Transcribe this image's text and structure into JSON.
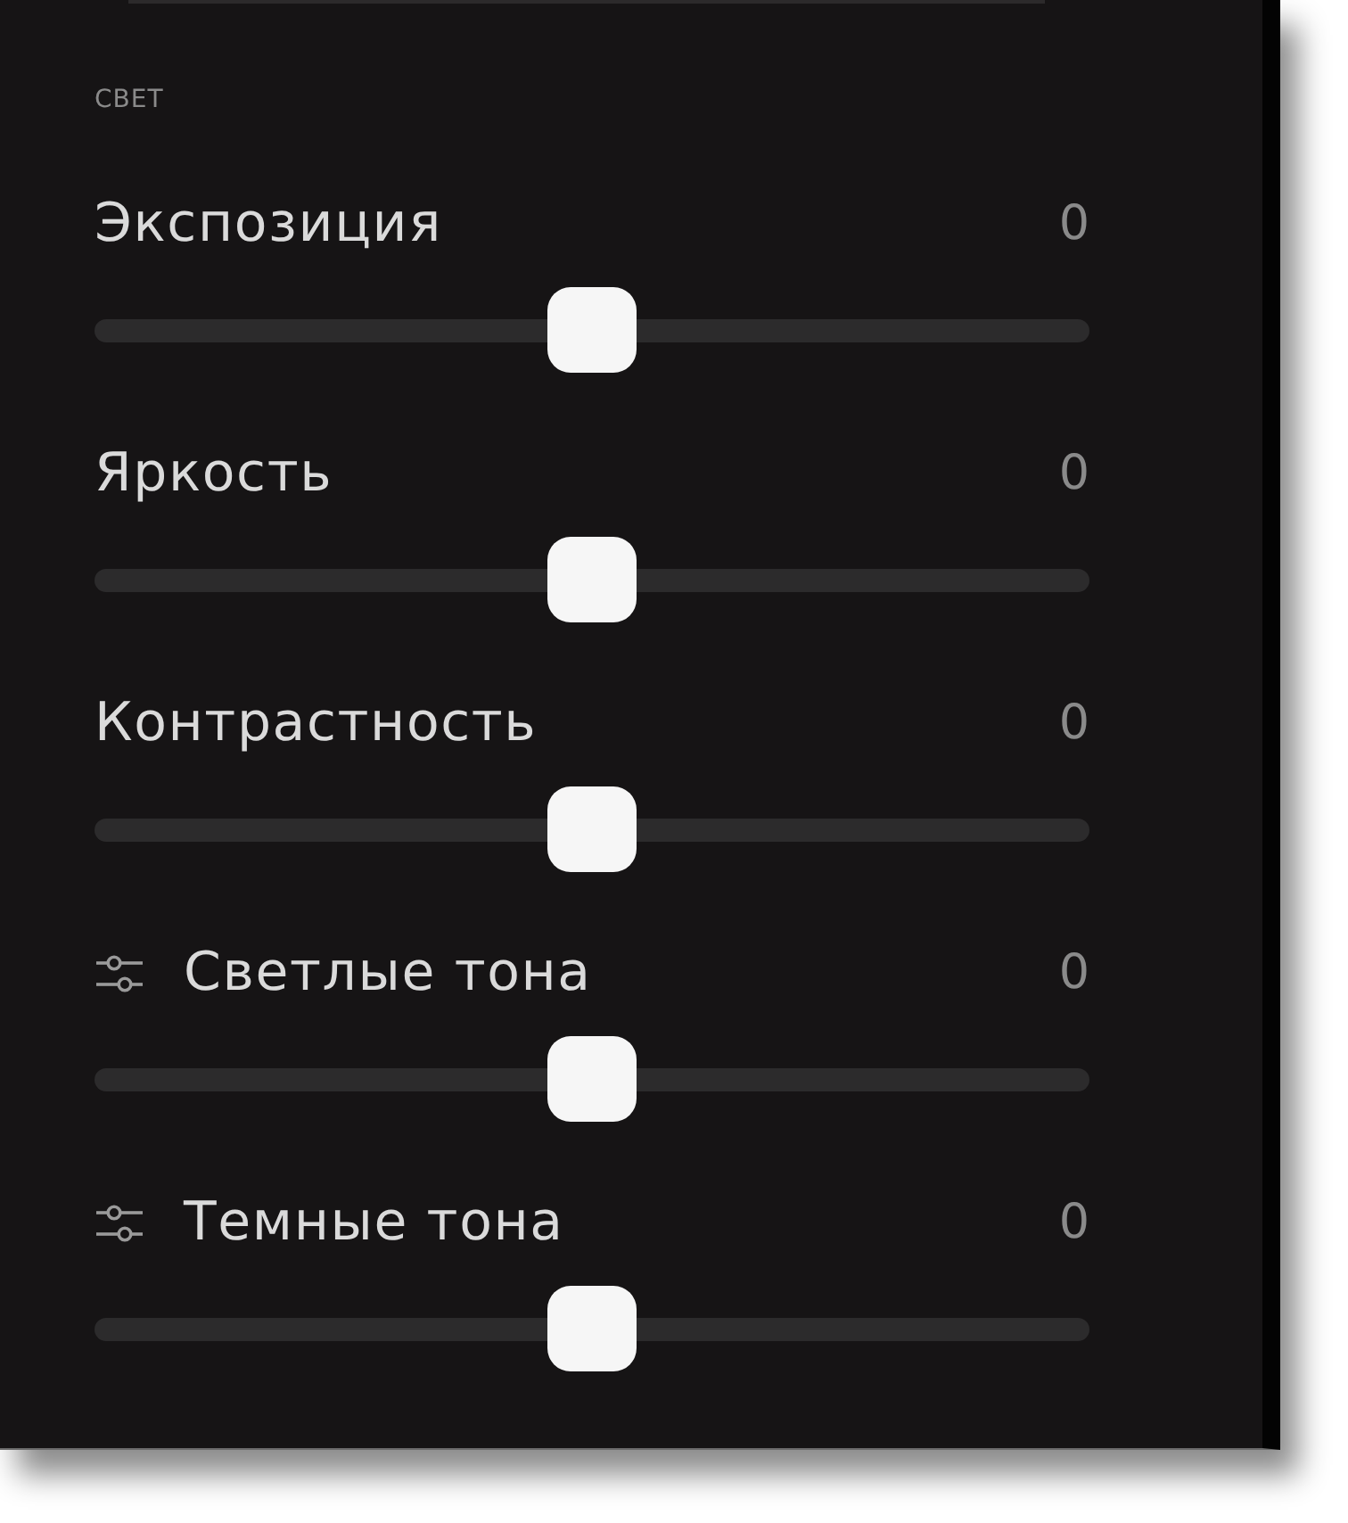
{
  "section": {
    "title": "СВЕТ"
  },
  "sliders": [
    {
      "kind": "plain",
      "label": "Экспозиция",
      "value": "0",
      "level": 0.5
    },
    {
      "kind": "plain",
      "label": "Яркость",
      "value": "0",
      "level": 0.5
    },
    {
      "kind": "plain",
      "label": "Контрастность",
      "value": "0",
      "level": 0.5
    },
    {
      "kind": "tone",
      "label": "Светлые тона",
      "value": "0",
      "level": 0.5
    },
    {
      "kind": "tone",
      "label": "Темные тона",
      "value": "0",
      "level": 0.5
    }
  ]
}
